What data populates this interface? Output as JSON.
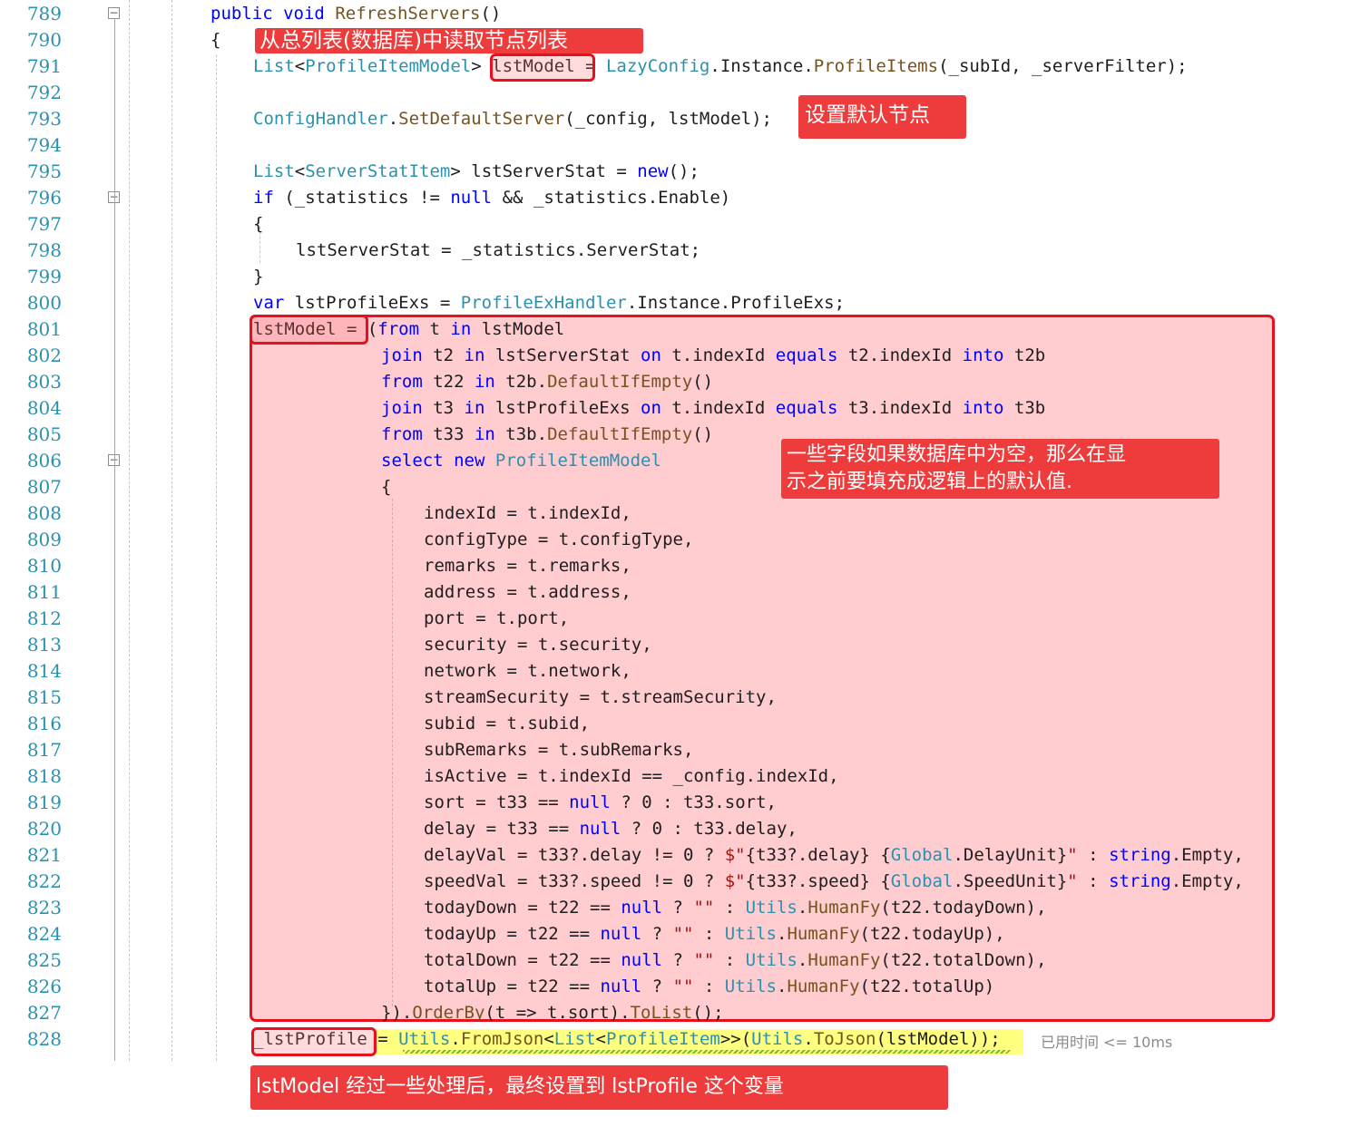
{
  "colors": {
    "keyword": "#0000ff",
    "type": "#2b91af",
    "method": "#74531f",
    "string": "#a31515",
    "plain": "#1e1e1e",
    "line_number": "#2b91af",
    "annotation_red": "#ee3b3b",
    "highlight_region": "#ffc8cc",
    "current_statement": "#ffff80",
    "squiggle_green": "#79b833"
  },
  "editor": {
    "lines": [
      {
        "num": "789",
        "indent": 0,
        "fold": "collapse",
        "tokens": [
          {
            "t": "public",
            "c": "kw"
          },
          {
            "t": " "
          },
          {
            "t": "void",
            "c": "kw"
          },
          {
            "t": " "
          },
          {
            "t": "RefreshServers",
            "c": "method"
          },
          {
            "t": "()"
          }
        ]
      },
      {
        "num": "790",
        "indent": 0,
        "tokens": [
          {
            "t": "{"
          }
        ]
      },
      {
        "num": "791",
        "indent": 1,
        "tokens": [
          {
            "t": "List",
            "c": "type"
          },
          {
            "t": "<"
          },
          {
            "t": "ProfileItemModel",
            "c": "type"
          },
          {
            "t": "> lstModel = "
          },
          {
            "t": "LazyConfig",
            "c": "type"
          },
          {
            "t": "."
          },
          {
            "t": "Instance"
          },
          {
            "t": "."
          },
          {
            "t": "ProfileItems",
            "c": "method"
          },
          {
            "t": "(_subId, _serverFilter);"
          }
        ]
      },
      {
        "num": "792",
        "indent": 0,
        "tokens": []
      },
      {
        "num": "793",
        "indent": 1,
        "tokens": [
          {
            "t": "ConfigHandler",
            "c": "type"
          },
          {
            "t": "."
          },
          {
            "t": "SetDefaultServer",
            "c": "method"
          },
          {
            "t": "(_config, lstModel);"
          }
        ]
      },
      {
        "num": "794",
        "indent": 0,
        "tokens": []
      },
      {
        "num": "795",
        "indent": 1,
        "tokens": [
          {
            "t": "List",
            "c": "type"
          },
          {
            "t": "<"
          },
          {
            "t": "ServerStatItem",
            "c": "type"
          },
          {
            "t": "> lstServerStat = "
          },
          {
            "t": "new",
            "c": "kw"
          },
          {
            "t": "();"
          }
        ]
      },
      {
        "num": "796",
        "indent": 1,
        "fold": "collapse",
        "tokens": [
          {
            "t": "if",
            "c": "kw"
          },
          {
            "t": " (_statistics != "
          },
          {
            "t": "null",
            "c": "kw"
          },
          {
            "t": " && _statistics.Enable)"
          }
        ]
      },
      {
        "num": "797",
        "indent": 1,
        "tokens": [
          {
            "t": "{"
          }
        ]
      },
      {
        "num": "798",
        "indent": 2,
        "tokens": [
          {
            "t": "lstServerStat = _statistics.ServerStat;"
          }
        ]
      },
      {
        "num": "799",
        "indent": 1,
        "tokens": [
          {
            "t": "}"
          }
        ]
      },
      {
        "num": "800",
        "indent": 1,
        "tokens": [
          {
            "t": "var",
            "c": "kw"
          },
          {
            "t": " lstProfileExs = "
          },
          {
            "t": "ProfileExHandler",
            "c": "type"
          },
          {
            "t": ".Instance.ProfileExs;"
          }
        ]
      },
      {
        "num": "801",
        "indent": 1,
        "tokens": [
          {
            "t": "lstModel = ("
          },
          {
            "t": "from",
            "c": "kw"
          },
          {
            "t": " t "
          },
          {
            "t": "in",
            "c": "kw"
          },
          {
            "t": " lstModel"
          }
        ]
      },
      {
        "num": "802",
        "indent": 4,
        "tokens": [
          {
            "t": "join",
            "c": "kw"
          },
          {
            "t": " t2 "
          },
          {
            "t": "in",
            "c": "kw"
          },
          {
            "t": " lstServerStat "
          },
          {
            "t": "on",
            "c": "kw"
          },
          {
            "t": " t.indexId "
          },
          {
            "t": "equals",
            "c": "kw"
          },
          {
            "t": " t2.indexId "
          },
          {
            "t": "into",
            "c": "kw"
          },
          {
            "t": " t2b"
          }
        ]
      },
      {
        "num": "803",
        "indent": 4,
        "tokens": [
          {
            "t": "from",
            "c": "kw"
          },
          {
            "t": " t22 "
          },
          {
            "t": "in",
            "c": "kw"
          },
          {
            "t": " t2b."
          },
          {
            "t": "DefaultIfEmpty",
            "c": "method"
          },
          {
            "t": "()"
          }
        ]
      },
      {
        "num": "804",
        "indent": 4,
        "tokens": [
          {
            "t": "join",
            "c": "kw"
          },
          {
            "t": " t3 "
          },
          {
            "t": "in",
            "c": "kw"
          },
          {
            "t": " lstProfileExs "
          },
          {
            "t": "on",
            "c": "kw"
          },
          {
            "t": " t.indexId "
          },
          {
            "t": "equals",
            "c": "kw"
          },
          {
            "t": " t3.indexId "
          },
          {
            "t": "into",
            "c": "kw"
          },
          {
            "t": " t3b"
          }
        ]
      },
      {
        "num": "805",
        "indent": 4,
        "tokens": [
          {
            "t": "from",
            "c": "kw"
          },
          {
            "t": " t33 "
          },
          {
            "t": "in",
            "c": "kw"
          },
          {
            "t": " t3b."
          },
          {
            "t": "DefaultIfEmpty",
            "c": "method"
          },
          {
            "t": "()"
          }
        ]
      },
      {
        "num": "806",
        "indent": 4,
        "fold": "collapse",
        "tokens": [
          {
            "t": "select",
            "c": "kw"
          },
          {
            "t": " "
          },
          {
            "t": "new",
            "c": "kw"
          },
          {
            "t": " "
          },
          {
            "t": "ProfileItemModel",
            "c": "type"
          }
        ]
      },
      {
        "num": "807",
        "indent": 4,
        "tokens": [
          {
            "t": "{"
          }
        ]
      },
      {
        "num": "808",
        "indent": 5,
        "tokens": [
          {
            "t": "indexId = t.indexId,"
          }
        ]
      },
      {
        "num": "809",
        "indent": 5,
        "tokens": [
          {
            "t": "configType = t.configType,"
          }
        ]
      },
      {
        "num": "810",
        "indent": 5,
        "tokens": [
          {
            "t": "remarks = t.remarks,"
          }
        ]
      },
      {
        "num": "811",
        "indent": 5,
        "tokens": [
          {
            "t": "address = t.address,"
          }
        ]
      },
      {
        "num": "812",
        "indent": 5,
        "tokens": [
          {
            "t": "port = t.port,"
          }
        ]
      },
      {
        "num": "813",
        "indent": 5,
        "tokens": [
          {
            "t": "security = t.security,"
          }
        ]
      },
      {
        "num": "814",
        "indent": 5,
        "tokens": [
          {
            "t": "network = t.network,"
          }
        ]
      },
      {
        "num": "815",
        "indent": 5,
        "tokens": [
          {
            "t": "streamSecurity = t.streamSecurity,"
          }
        ]
      },
      {
        "num": "816",
        "indent": 5,
        "tokens": [
          {
            "t": "subid = t.subid,"
          }
        ]
      },
      {
        "num": "817",
        "indent": 5,
        "tokens": [
          {
            "t": "subRemarks = t.subRemarks,"
          }
        ]
      },
      {
        "num": "818",
        "indent": 5,
        "tokens": [
          {
            "t": "isActive = t.indexId == _config.indexId,"
          }
        ]
      },
      {
        "num": "819",
        "indent": 5,
        "tokens": [
          {
            "t": "sort = t33 == "
          },
          {
            "t": "null",
            "c": "kw"
          },
          {
            "t": " ? 0 : t33.sort,"
          }
        ]
      },
      {
        "num": "820",
        "indent": 5,
        "tokens": [
          {
            "t": "delay = t33 == "
          },
          {
            "t": "null",
            "c": "kw"
          },
          {
            "t": " ? 0 : t33.delay,"
          }
        ]
      },
      {
        "num": "821",
        "indent": 5,
        "tokens": [
          {
            "t": "delayVal = t33?.delay != 0 ? "
          },
          {
            "t": "$\"",
            "c": "str"
          },
          {
            "t": "{t33?.delay} "
          },
          {
            "t": "{"
          },
          {
            "t": "Global",
            "c": "type"
          },
          {
            "t": ".DelayUnit}"
          },
          {
            "t": "\"",
            "c": "str"
          },
          {
            "t": " : "
          },
          {
            "t": "string",
            "c": "kw"
          },
          {
            "t": ".Empty,"
          }
        ]
      },
      {
        "num": "822",
        "indent": 5,
        "tokens": [
          {
            "t": "speedVal = t33?.speed != 0 ? "
          },
          {
            "t": "$\"",
            "c": "str"
          },
          {
            "t": "{t33?.speed} "
          },
          {
            "t": "{"
          },
          {
            "t": "Global",
            "c": "type"
          },
          {
            "t": ".SpeedUnit}"
          },
          {
            "t": "\"",
            "c": "str"
          },
          {
            "t": " : "
          },
          {
            "t": "string",
            "c": "kw"
          },
          {
            "t": ".Empty,"
          }
        ]
      },
      {
        "num": "823",
        "indent": 5,
        "tokens": [
          {
            "t": "todayDown = t22 == "
          },
          {
            "t": "null",
            "c": "kw"
          },
          {
            "t": " ? "
          },
          {
            "t": "\"\"",
            "c": "str"
          },
          {
            "t": " : "
          },
          {
            "t": "Utils",
            "c": "type"
          },
          {
            "t": "."
          },
          {
            "t": "HumanFy",
            "c": "method"
          },
          {
            "t": "(t22.todayDown),"
          }
        ]
      },
      {
        "num": "824",
        "indent": 5,
        "tokens": [
          {
            "t": "todayUp = t22 == "
          },
          {
            "t": "null",
            "c": "kw"
          },
          {
            "t": " ? "
          },
          {
            "t": "\"\"",
            "c": "str"
          },
          {
            "t": " : "
          },
          {
            "t": "Utils",
            "c": "type"
          },
          {
            "t": "."
          },
          {
            "t": "HumanFy",
            "c": "method"
          },
          {
            "t": "(t22.todayUp),"
          }
        ]
      },
      {
        "num": "825",
        "indent": 5,
        "tokens": [
          {
            "t": "totalDown = t22 == "
          },
          {
            "t": "null",
            "c": "kw"
          },
          {
            "t": " ? "
          },
          {
            "t": "\"\"",
            "c": "str"
          },
          {
            "t": " : "
          },
          {
            "t": "Utils",
            "c": "type"
          },
          {
            "t": "."
          },
          {
            "t": "HumanFy",
            "c": "method"
          },
          {
            "t": "(t22.totalDown),"
          }
        ]
      },
      {
        "num": "826",
        "indent": 5,
        "tokens": [
          {
            "t": "totalUp = t22 == "
          },
          {
            "t": "null",
            "c": "kw"
          },
          {
            "t": " ? "
          },
          {
            "t": "\"\"",
            "c": "str"
          },
          {
            "t": " : "
          },
          {
            "t": "Utils",
            "c": "type"
          },
          {
            "t": "."
          },
          {
            "t": "HumanFy",
            "c": "method"
          },
          {
            "t": "(t22.totalUp)"
          }
        ]
      },
      {
        "num": "827",
        "indent": 4,
        "tokens": [
          {
            "t": "})."
          },
          {
            "t": "OrderBy",
            "c": "method"
          },
          {
            "t": "(t => t.sort)."
          },
          {
            "t": "ToList",
            "c": "method"
          },
          {
            "t": "();"
          }
        ]
      },
      {
        "num": "828",
        "indent": 1,
        "tokens": [
          {
            "t": "_lstProfile = "
          },
          {
            "t": "Utils",
            "c": "type"
          },
          {
            "t": "."
          },
          {
            "t": "FromJson",
            "c": "method"
          },
          {
            "t": "<"
          },
          {
            "t": "List",
            "c": "type"
          },
          {
            "t": "<"
          },
          {
            "t": "ProfileItem",
            "c": "type"
          },
          {
            "t": ">>("
          },
          {
            "t": "Utils",
            "c": "type"
          },
          {
            "t": "."
          },
          {
            "t": "ToJson",
            "c": "method"
          },
          {
            "t": "(lstModel));"
          }
        ]
      }
    ],
    "timing_hint": "已用时间 <= 10ms"
  },
  "annotations": {
    "read_list": "从总列表(数据库)中读取节点列表",
    "set_default": "设置默认节点",
    "fill_defaults": "一些字段如果数据库中为空，那么在显\n示之前要填充成逻辑上的默认值.",
    "final_assign": "lstModel 经过一些处理后，最终设置到 lstProfile 这个变量"
  }
}
